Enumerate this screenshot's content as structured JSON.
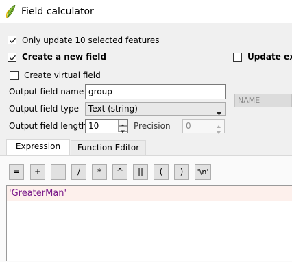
{
  "window": {
    "title": "Field calculator",
    "app_icon": "qgis-leaf-icon"
  },
  "options": {
    "only_update_label": "Only update 10 selected features",
    "only_update_checked": true,
    "create_new_field_label": "Create a new field",
    "create_new_field_checked": true,
    "update_existing_label": "Update ex",
    "update_existing_checked": false,
    "virtual_field_label": "Create virtual field",
    "virtual_field_checked": false
  },
  "form": {
    "output_name_label": "Output field name",
    "output_name_value": "group",
    "output_type_label": "Output field type",
    "output_type_value": "Text (string)",
    "output_length_label": "Output field length",
    "output_length_value": "10",
    "precision_label": "Precision",
    "precision_value": "0",
    "existing_field_value": "NAME"
  },
  "tabs": [
    {
      "label": "Expression",
      "active": true
    },
    {
      "label": "Function Editor",
      "active": false
    }
  ],
  "operators": [
    "=",
    "+",
    "-",
    "/",
    "*",
    "^",
    "||",
    "(",
    ")",
    "'\\n'"
  ],
  "editor": {
    "expression": "'GreaterMan'"
  },
  "colors": {
    "window_bg": "#f0f0f0",
    "titlebar_bg": "#ffffff",
    "expression_string": "#7a1a8a",
    "editor_line_highlight": "#fdf0ec"
  }
}
